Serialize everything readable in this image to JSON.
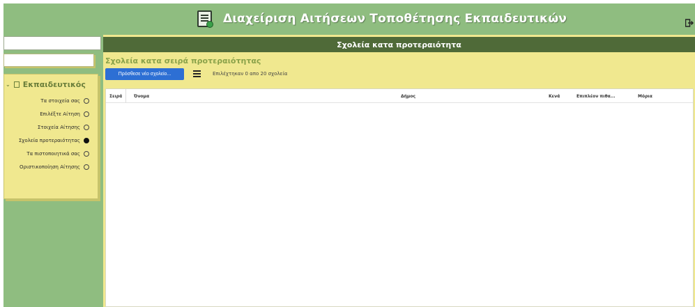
{
  "header": {
    "title": "Διαχείριση Αιτήσεων Τοποθέτησης Εκπαιδευτικών",
    "app_icon": "document-edit-icon",
    "logout_icon": "logout-icon"
  },
  "sidebar": {
    "search_value": "",
    "secondary_value": "",
    "panel_title": "Εκπαιδευτικός",
    "items": [
      {
        "label": "Τα στοιχεία σας",
        "checked": false
      },
      {
        "label": "Επιλέξτε Αίτηση",
        "checked": false
      },
      {
        "label": "Στοιχεία Αίτησης",
        "checked": false
      },
      {
        "label": "Σχολεία προτεραιότητας",
        "checked": true
      },
      {
        "label": "Τα πιστοποιητικά σας",
        "checked": false
      },
      {
        "label": "Οριστικοποίηση Αίτησης",
        "checked": false
      }
    ]
  },
  "main": {
    "header_title": "Σχολεία κατα προτεραιότητα",
    "section_title": "Σχολεία κατα σειρά προτεραιότητας",
    "add_button_label": "Πρόσθεσε νέο σχολείο...",
    "selected_info": "Επιλέχτηκαν 0 απο 20 σχολεία",
    "columns": [
      "Σειρά",
      "Όνομα",
      "Δήμος",
      "Κενά",
      "Επιπλέον πιθα...",
      "Μόρια"
    ],
    "rows": []
  },
  "colors": {
    "background_green": "#8fbd80",
    "panel_yellow": "#f0e88f",
    "header_dark_green": "#4f6a38",
    "button_blue": "#2d6fd4"
  }
}
